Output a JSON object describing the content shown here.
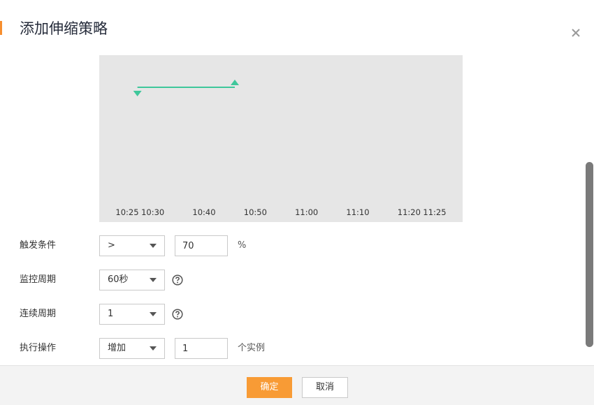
{
  "dialog": {
    "title": "添加伸缩策略",
    "accent_color": "#f78f2f"
  },
  "chart_data": {
    "type": "line",
    "x_tick_labels": [
      "10:25",
      "10:30",
      "10:40",
      "10:50",
      "11:00",
      "11:10",
      "11:20",
      "11:25"
    ],
    "series": [
      {
        "x": [
          "10:27",
          "10:46"
        ],
        "y": [
          1,
          1
        ],
        "color": "#3fc79b"
      }
    ],
    "markers": [
      {
        "time": "10:27",
        "shape": "triangle-down"
      },
      {
        "time": "10:46",
        "shape": "triangle-up"
      }
    ],
    "background": "#e6e6e6",
    "grid": false
  },
  "form": {
    "trigger": {
      "label": "触发条件",
      "operator": ">",
      "threshold": "70",
      "unit": "%"
    },
    "monitor_period": {
      "label": "监控周期",
      "value": "60秒"
    },
    "consecutive_periods": {
      "label": "连续周期",
      "value": "1"
    },
    "action": {
      "label": "执行操作",
      "operation": "增加",
      "count": "1",
      "unit": "个实例"
    }
  },
  "footer": {
    "confirm_label": "确定",
    "cancel_label": "取消",
    "confirm_color": "#f89b35"
  },
  "icons": {
    "close": "close-icon",
    "help": "help-icon",
    "caret": "chevron-down-icon"
  }
}
